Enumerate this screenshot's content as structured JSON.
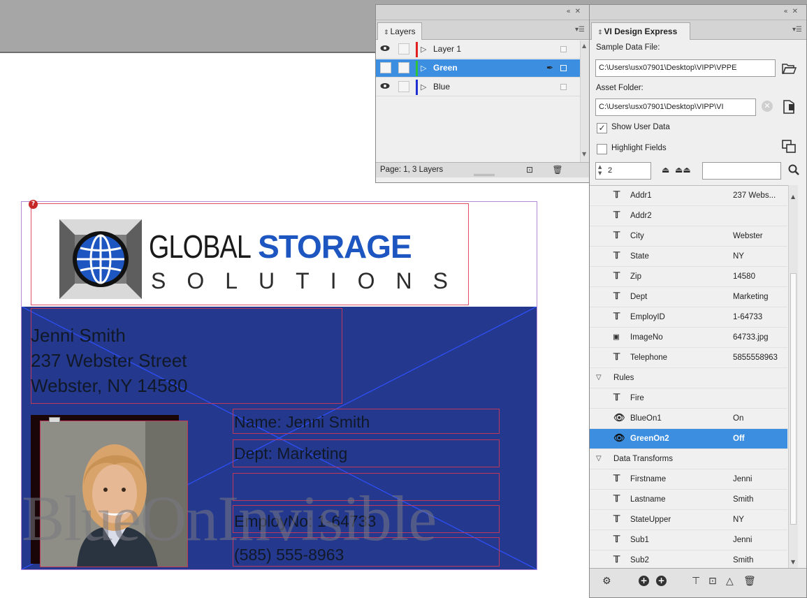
{
  "layers_panel": {
    "tab_label": "Layers",
    "layers": [
      {
        "name": "Layer 1",
        "color": "#e02020",
        "visible": true,
        "selected": false
      },
      {
        "name": "Green",
        "color": "#2fc43a",
        "visible": false,
        "selected": true
      },
      {
        "name": "Blue",
        "color": "#2030d0",
        "visible": true,
        "selected": false
      }
    ],
    "footer_text": "Page: 1, 3 Layers"
  },
  "vi_panel": {
    "tab_label": "VI Design Express",
    "sample_data_label": "Sample Data File:",
    "sample_data_value": "C:\\Users\\usx07901\\Desktop\\VIPP\\VPPE",
    "asset_folder_label": "Asset Folder:",
    "asset_folder_value": "C:\\Users\\usx07901\\Desktop\\VIPP\\VI",
    "show_user_data_label": "Show User Data",
    "show_user_data_checked": true,
    "highlight_fields_label": "Highlight Fields",
    "highlight_fields_checked": false,
    "record_number": "2",
    "fields": [
      {
        "name": "Addr1",
        "value": "237 Webs...",
        "icon": "text-field-icon"
      },
      {
        "name": "Addr2",
        "value": "",
        "icon": "text-field-icon"
      },
      {
        "name": "City",
        "value": "Webster",
        "icon": "text-field-icon"
      },
      {
        "name": "State",
        "value": "NY",
        "icon": "text-field-icon"
      },
      {
        "name": "Zip",
        "value": "14580",
        "icon": "text-field-icon"
      },
      {
        "name": "Dept",
        "value": "Marketing",
        "icon": "text-field-icon"
      },
      {
        "name": "EmployID",
        "value": "1-64733",
        "icon": "text-field-icon"
      },
      {
        "name": "ImageNo",
        "value": "64733.jpg",
        "icon": "image-field-icon"
      },
      {
        "name": "Telephone",
        "value": "5855558963",
        "icon": "text-field-icon"
      }
    ],
    "rules_label": "Rules",
    "rules": [
      {
        "name": "Fire",
        "value": "",
        "icon": "rule-fire-icon",
        "selected": false
      },
      {
        "name": "BlueOn1",
        "value": "On",
        "icon": "eye-icon",
        "selected": false
      },
      {
        "name": "GreenOn2",
        "value": "Off",
        "icon": "eye-icon",
        "selected": true
      }
    ],
    "transforms_label": "Data Transforms",
    "transforms": [
      {
        "name": "Firstname",
        "value": "Jenni"
      },
      {
        "name": "Lastname",
        "value": "Smith"
      },
      {
        "name": "StateUpper",
        "value": "NY"
      },
      {
        "name": "Sub1",
        "value": "Jenni"
      },
      {
        "name": "Sub2",
        "value": "Smith"
      }
    ]
  },
  "card": {
    "logo_word_1": "GLOBAL",
    "logo_word_2": "STORAGE",
    "logo_word_3": "SOLUTIONS",
    "address_line_1": "Jenni Smith",
    "address_line_2": "237 Webster Street",
    "address_line_3": "Webster, NY 14580",
    "name_line": "Name: Jenni Smith",
    "dept_line": "Dept: Marketing",
    "employ_line": "EmployNo: 1-64733",
    "phone_line": "(585) 555-8963",
    "watermark": "BlueOnInvisible",
    "frame_badge": "?"
  }
}
